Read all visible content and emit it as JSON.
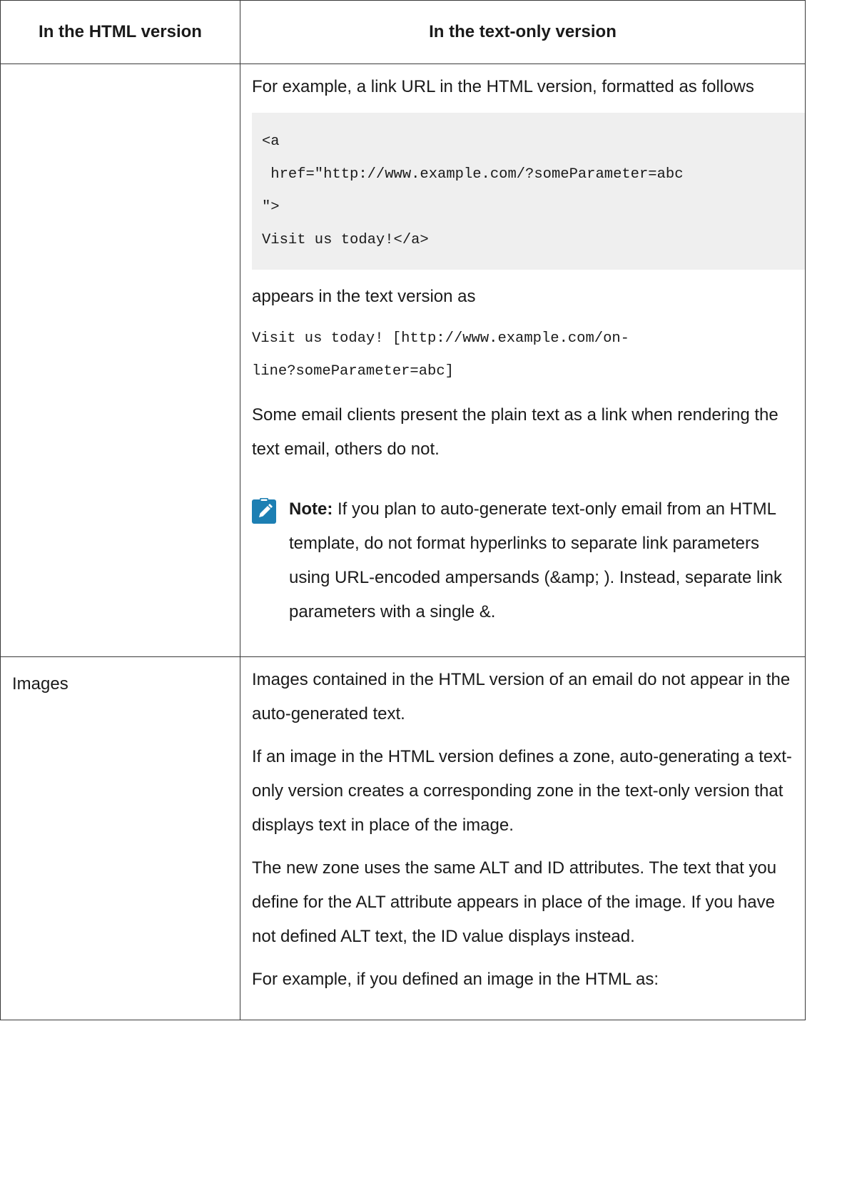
{
  "table": {
    "headers": [
      "In the HTML version",
      "In the text-only version"
    ],
    "row1": {
      "col1": "",
      "intro": "For example, a link URL in the HTML version, formatted as follows",
      "code_lines": [
        "<a",
        " href=\"http://www.example.com/?someParameter=abc",
        "\">",
        "Visit us today!</a>"
      ],
      "appears_text": "appears in the text version as",
      "mono_lines": [
        "Visit us today! [http://www.example.com/on-",
        "line?someParameter=abc]"
      ],
      "clients_text": "Some email clients present the plain text as a link when rendering the text email, others do not.",
      "note": {
        "icon": "pencil-note-icon",
        "label": "Note:",
        "text": " If you plan to auto-generate text-only email from an HTML template, do not format hyperlinks to separate link parameters using URL-encoded ampersands (&amp; ). Instead, separate link parameters with a single &."
      }
    },
    "row2": {
      "col1": "Images",
      "paragraphs": [
        "Images contained in the HTML version of an email do not appear in the auto-generated text.",
        "If an image in the HTML version defines a zone, auto-generating a text-only version creates a corresponding zone in the text-only version that displays text in place of the image.",
        "The new zone uses the same ALT and ID attributes. The text that you define for the ALT attribute appears in place of the image. If you have not defined ALT text, the ID value displays instead.",
        "For example, if you defined an image in the HTML as:"
      ]
    }
  },
  "colors": {
    "note_icon": "#1c7fb3",
    "code_bg": "#efefef",
    "border": "#3a3a3a"
  }
}
